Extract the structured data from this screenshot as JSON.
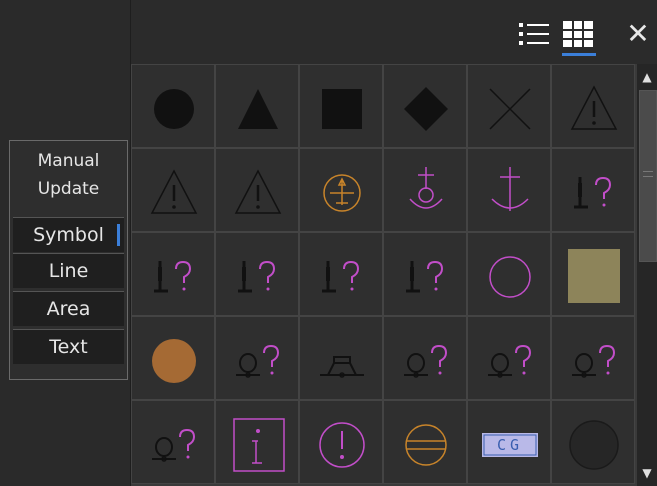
{
  "window": {
    "close_label": "✕"
  },
  "view_toggle": {
    "list_icon": "list-view-icon",
    "grid_icon": "grid-view-icon",
    "selected": "grid"
  },
  "menu": {
    "manual_update_line1": "Manual",
    "manual_update_line2": "Update",
    "items": [
      {
        "label": "Symbol",
        "selected": true
      },
      {
        "label": "Line",
        "selected": false
      },
      {
        "label": "Area",
        "selected": false
      },
      {
        "label": "Text",
        "selected": false
      }
    ]
  },
  "symbols": [
    [
      {
        "icon": "filled-circle-icon"
      },
      {
        "icon": "filled-triangle-icon"
      },
      {
        "icon": "filled-square-icon"
      },
      {
        "icon": "filled-diamond-icon"
      },
      {
        "icon": "cross-icon"
      },
      {
        "icon": "warning-triangle-icon"
      }
    ],
    [
      {
        "icon": "warning-triangle-icon"
      },
      {
        "icon": "warning-triangle-icon"
      },
      {
        "icon": "airplane-circle-icon"
      },
      {
        "icon": "anchorage-icon"
      },
      {
        "icon": "anchor-icon"
      },
      {
        "icon": "unknown-mark-icon"
      }
    ],
    [
      {
        "icon": "unknown-mark-icon"
      },
      {
        "icon": "unknown-mark-icon"
      },
      {
        "icon": "unknown-mark-icon"
      },
      {
        "icon": "unknown-mark-icon"
      },
      {
        "icon": "open-circle-icon"
      },
      {
        "icon": "khaki-square-icon"
      }
    ],
    [
      {
        "icon": "brown-circle-icon"
      },
      {
        "icon": "unknown-buoy-icon"
      },
      {
        "icon": "platform-icon"
      },
      {
        "icon": "unknown-buoy-icon"
      },
      {
        "icon": "unknown-buoy-icon"
      },
      {
        "icon": "unknown-buoy-icon"
      }
    ],
    [
      {
        "icon": "unknown-buoy-icon"
      },
      {
        "icon": "info-box-icon"
      },
      {
        "icon": "exclamation-circle-icon"
      },
      {
        "icon": "striped-circle-icon"
      },
      {
        "icon": "cg-label-icon",
        "text": "CG"
      },
      {
        "icon": "dark-circle-icon"
      }
    ]
  ],
  "colors": {
    "accent": "#3b7fd9",
    "black_symbol": "#111111",
    "magenta": "#c24ec9",
    "orange": "#c8842a",
    "khaki": "#8d845a",
    "brown": "#a56a34",
    "cg_bg": "#b9b9e8",
    "cg_text": "#3a5fb0"
  },
  "scrollbar": {
    "up": "▲",
    "down": "▼"
  }
}
